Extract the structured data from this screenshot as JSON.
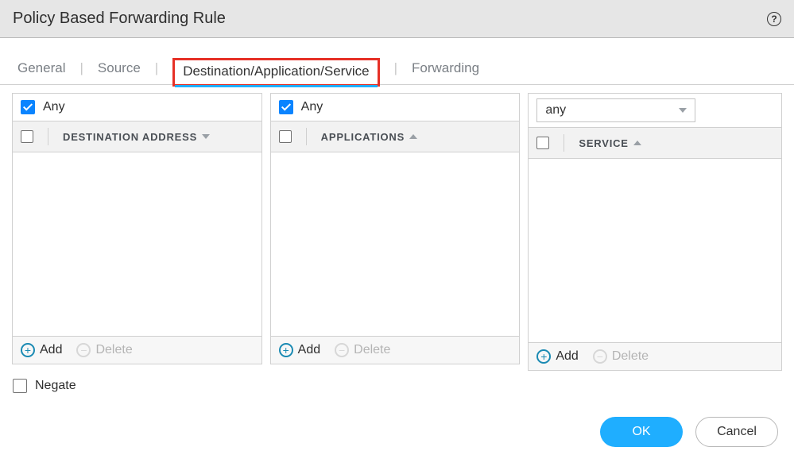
{
  "dialog": {
    "title": "Policy Based Forwarding Rule"
  },
  "tabs": {
    "general": "General",
    "source": "Source",
    "dasvc": "Destination/Application/Service",
    "forwarding": "Forwarding"
  },
  "panels": {
    "dest": {
      "any_label": "Any",
      "header": "DESTINATION ADDRESS"
    },
    "apps": {
      "any_label": "Any",
      "header": "APPLICATIONS"
    },
    "service": {
      "select_value": "any",
      "header": "SERVICE"
    }
  },
  "footer": {
    "add": "Add",
    "delete": "Delete"
  },
  "negate_label": "Negate",
  "actions": {
    "ok": "OK",
    "cancel": "Cancel"
  }
}
